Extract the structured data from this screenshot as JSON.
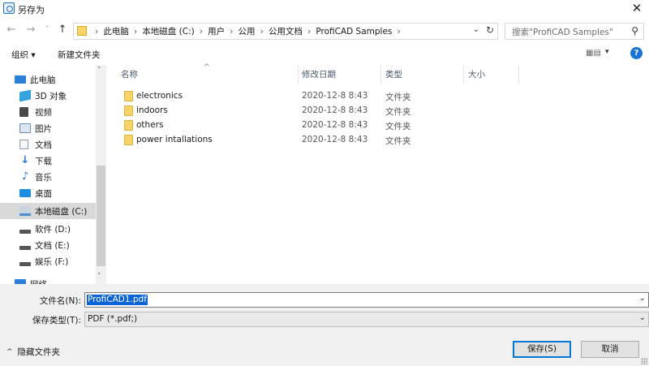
{
  "window": {
    "title": "另存为",
    "close_glyph": "✕"
  },
  "nav_buttons": {
    "back": "←",
    "forward": "→",
    "recent": "˅",
    "up": "↑"
  },
  "address": {
    "crumbs": [
      "此电脑",
      "本地磁盘 (C:)",
      "用户",
      "公用",
      "公用文档",
      "ProfiCAD Samples"
    ],
    "separator": "›",
    "dropdown_glyph": "⌄",
    "refresh_glyph": "↻"
  },
  "search": {
    "placeholder": "搜索\"ProfiCAD Samples\"",
    "icon_glyph": "⚲"
  },
  "toolbar": {
    "organize": "组织 ▾",
    "new_folder": "新建文件夹",
    "view_glyph": "▦▤",
    "view_dd": "▾",
    "help": "?"
  },
  "sidebar": {
    "items": [
      {
        "label": "此电脑",
        "icon": "computer-icon",
        "color": "#2b7fd6"
      },
      {
        "label": "3D 对象",
        "icon": "cube-3d-icon",
        "color": "#34a4e0"
      },
      {
        "label": "视频",
        "icon": "video-icon",
        "color": "#4a4a4a"
      },
      {
        "label": "图片",
        "icon": "pictures-icon",
        "color": "#6a8db0"
      },
      {
        "label": "文档",
        "icon": "documents-icon",
        "color": "#8a9aac"
      },
      {
        "label": "下载",
        "icon": "download-icon",
        "color": "#2477d6"
      },
      {
        "label": "音乐",
        "icon": "music-icon",
        "color": "#2a7ad5"
      },
      {
        "label": "桌面",
        "icon": "desktop-icon",
        "color": "#1c8ee0"
      },
      {
        "label": "本地磁盘 (C:)",
        "icon": "system-drive-icon",
        "color": "#4a8ed0"
      },
      {
        "label": "软件 (D:)",
        "icon": "drive-icon",
        "color": "#555555"
      },
      {
        "label": "文档 (E:)",
        "icon": "drive-icon",
        "color": "#555555"
      },
      {
        "label": "娱乐 (F:)",
        "icon": "drive-icon",
        "color": "#555555"
      },
      {
        "label": "网络",
        "icon": "network-icon",
        "color": "#2b7fd6"
      }
    ],
    "selected_index": 8
  },
  "columns": {
    "name": "名称",
    "date": "修改日期",
    "type": "类型",
    "size": "大小",
    "sort_caret": "^"
  },
  "files": [
    {
      "name": "electronics",
      "date": "2020-12-8 8:43",
      "type": "文件夹"
    },
    {
      "name": "indoors",
      "date": "2020-12-8 8:43",
      "type": "文件夹"
    },
    {
      "name": "others",
      "date": "2020-12-8 8:43",
      "type": "文件夹"
    },
    {
      "name": "power intallations",
      "date": "2020-12-8 8:43",
      "type": "文件夹"
    }
  ],
  "form": {
    "filename_label": "文件名(N):",
    "filename_value": "ProfiCAD1.pdf",
    "filetype_label": "保存类型(T):",
    "filetype_value": "PDF  (*.pdf;)"
  },
  "footer": {
    "hide_folders": "隐藏文件夹",
    "save": "保存(S)",
    "cancel": "取消"
  },
  "scroll": {
    "up": "˄",
    "down": "˅"
  }
}
